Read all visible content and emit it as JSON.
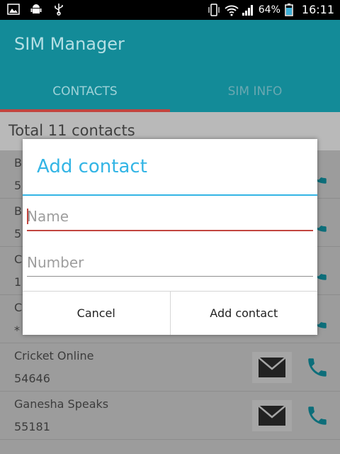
{
  "status_bar": {
    "battery_percent": "64%",
    "time": "16:11",
    "left_icons": [
      "image-icon",
      "android-icon",
      "usb-icon"
    ],
    "right_icons": [
      "phone-vibrate-icon",
      "wifi-icon",
      "signal-icon",
      "battery-icon"
    ]
  },
  "app": {
    "title": "SIM Manager"
  },
  "tabs": [
    {
      "label": "CONTACTS",
      "selected": true
    },
    {
      "label": "SIM INFO",
      "selected": false
    }
  ],
  "summary": {
    "total_text": "Total 11 contacts"
  },
  "contacts": [
    {
      "name": "B",
      "number": "5"
    },
    {
      "name": "B",
      "number": "5"
    },
    {
      "name": "C",
      "number": "1"
    },
    {
      "name": "C",
      "number": "*"
    },
    {
      "name": "Cricket Online",
      "number": "54646"
    },
    {
      "name": "Ganesha Speaks",
      "number": "55181"
    }
  ],
  "dialog": {
    "title": "Add contact",
    "name_placeholder": "Name",
    "number_placeholder": "Number",
    "cancel_label": "Cancel",
    "confirm_label": "Add contact"
  },
  "colors": {
    "accent": "#138b98",
    "tab_indicator": "#c2453f",
    "dialog_title": "#33b5e5",
    "call_icon": "#0d6e7a"
  }
}
